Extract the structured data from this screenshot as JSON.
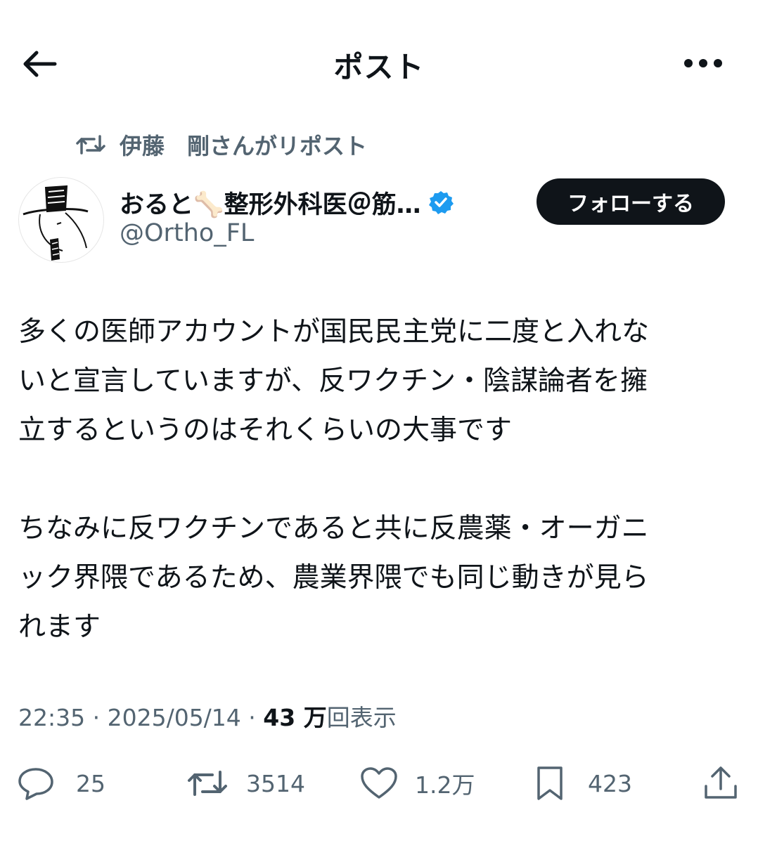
{
  "header": {
    "title": "ポスト",
    "back_icon": "arrow-left-icon",
    "more_icon": "more-horizontal-icon"
  },
  "repost_context": {
    "text": "伊藤　剛さんがリポスト",
    "icon": "repost-icon"
  },
  "author": {
    "display_name": "おると🦴整形外科医＠筋…",
    "handle": "@Ortho_FL",
    "verified": true,
    "verified_color": "#1d9bf0"
  },
  "follow_button": {
    "label": "フォローする"
  },
  "post": {
    "paragraph1": [
      "多くの医師アカウントが国民民主党に二度と入れな",
      "いと宣言していますが、反ワクチン・陰謀論者を擁",
      "立するというのはそれくらいの大事です"
    ],
    "paragraph2": [
      "ちなみに反ワクチンであると共に反農薬・オーガニ",
      "ック界隈であるため、農業界隈でも同じ動きが見ら",
      "れます"
    ]
  },
  "meta": {
    "time": "22:35",
    "separator": " · ",
    "date": "2025/05/14",
    "views_count": "43 万",
    "views_label": "回表示"
  },
  "actions": {
    "replies": "25",
    "reposts": "3514",
    "likes": "1.2万",
    "bookmarks": "423"
  },
  "colors": {
    "text_primary": "#0f1419",
    "text_secondary": "#536471",
    "follow_bg": "#0f1419"
  }
}
